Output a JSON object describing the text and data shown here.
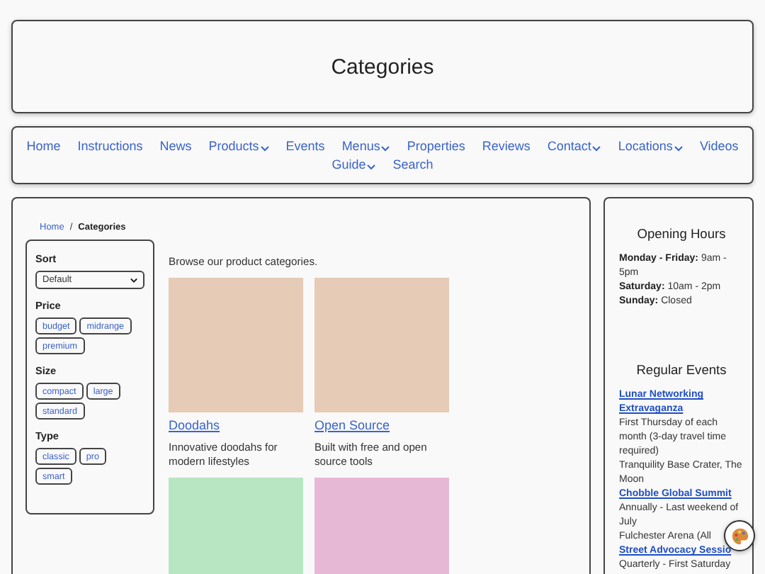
{
  "header": {
    "title": "Categories"
  },
  "nav": [
    {
      "label": "Home",
      "has_menu": false
    },
    {
      "label": "Instructions",
      "has_menu": false
    },
    {
      "label": "News",
      "has_menu": false
    },
    {
      "label": "Products",
      "has_menu": true
    },
    {
      "label": "Events",
      "has_menu": false
    },
    {
      "label": "Menus",
      "has_menu": true
    },
    {
      "label": "Properties",
      "has_menu": false
    },
    {
      "label": "Reviews",
      "has_menu": false
    },
    {
      "label": "Contact",
      "has_menu": true
    },
    {
      "label": "Locations",
      "has_menu": true
    },
    {
      "label": "Videos",
      "has_menu": false
    },
    {
      "label": "Guide",
      "has_menu": true
    },
    {
      "label": "Search",
      "has_menu": false
    }
  ],
  "breadcrumb": {
    "links": [
      "Home"
    ],
    "separator": "/",
    "current": "Categories"
  },
  "filters": {
    "sort": {
      "label": "Sort",
      "value": "Default"
    },
    "groups": [
      {
        "label": "Price",
        "options": [
          "budget",
          "midrange",
          "premium"
        ]
      },
      {
        "label": "Size",
        "options": [
          "compact",
          "large",
          "standard"
        ]
      },
      {
        "label": "Type",
        "options": [
          "classic",
          "pro",
          "smart"
        ]
      }
    ]
  },
  "intro": "Browse our product categories.",
  "categories": [
    {
      "title": "Doodahs",
      "description": "Innovative doodahs for modern lifestyles",
      "color": "#e6cbb7"
    },
    {
      "title": "Open Source",
      "description": "Built with free and open source tools",
      "color": "#e6cbb7"
    },
    {
      "color": "#b8e6c2"
    },
    {
      "color": "#e6b8d5"
    }
  ],
  "sidebar": {
    "hours_title": "Opening Hours",
    "hours": [
      "**Monday - Friday:** 9am - 5pm",
      "**Saturday:** 10am - 2pm",
      "**Sunday:** Closed"
    ],
    "events_title": "Regular Events",
    "events": [
      {
        "title": "Lunar Networking Extravaganza",
        "lines": [
          "First Thursday of each month (3-day travel time required)",
          "Tranquility Base Crater, The Moon"
        ]
      },
      {
        "title": "Chobble Global Summit",
        "lines": [
          "Annually - Last weekend of July",
          "Fulchester Arena (All"
        ]
      },
      {
        "title": "Street Advocacy Sessio",
        "lines": [
          "Quarterly - First Saturday"
        ]
      }
    ]
  }
}
